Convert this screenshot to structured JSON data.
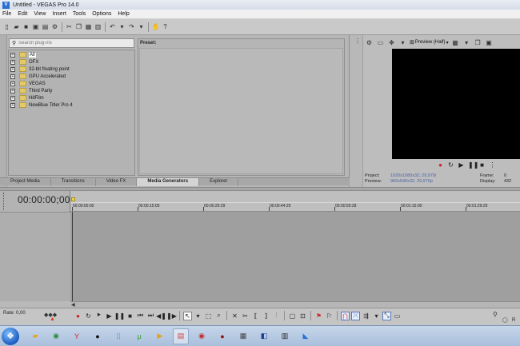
{
  "window": {
    "title": "Untitled - VEGAS Pro 14.0",
    "logo_letter": "V"
  },
  "menu": [
    "File",
    "Edit",
    "View",
    "Insert",
    "Tools",
    "Options",
    "Help"
  ],
  "toolbar_icons": [
    "new-icon",
    "open-icon",
    "save-icon",
    "save-as-icon",
    "render-icon",
    "properties-icon",
    "cut-icon",
    "copy-icon",
    "paste-icon",
    "delete-icon",
    "undo-icon",
    "redo-icon",
    "enable-snapping-icon",
    "whats-this-icon"
  ],
  "plugin_browser": {
    "search_placeholder": "Search plug-ins",
    "items": [
      "All",
      "OFX",
      "32-bit floating point",
      "GPU Accelerated",
      "VEGAS",
      "Third Party",
      "HitFilm",
      "NewBlue Titler Pro 4"
    ],
    "selected_index": 0
  },
  "preset_panel": {
    "header": "Preset:"
  },
  "dock_tabs": [
    {
      "label": "Project Media",
      "active": false
    },
    {
      "label": "Transitions",
      "active": false
    },
    {
      "label": "Video FX",
      "active": false
    },
    {
      "label": "Media Generators",
      "active": true
    },
    {
      "label": "Explorer",
      "active": false
    }
  ],
  "preview": {
    "quality": "Preview (Half)",
    "project_label": "Project:",
    "project_value": "1920x1080x32; 29,970i",
    "preview_label": "Preview:",
    "preview_value": "960x540x32; 29,970p",
    "frame_label": "Frame:",
    "frame_value": "0",
    "display_label": "Display:",
    "display_value": "432"
  },
  "timeline": {
    "timecode": "00:00:00;00",
    "ruler_ticks": [
      "00:00:00:00",
      "00:00:15:00",
      "00:00:29:29",
      "00:00:44:29",
      "00:00:59:28",
      "00:01:15:00",
      "00:01:29:29"
    ]
  },
  "transport": {
    "rate": "Rate: 0,00"
  },
  "taskbar": {
    "apps": [
      "explorer-icon",
      "chrome-icon",
      "yandex-icon",
      "media-icon",
      "files-icon",
      "utorrent-icon",
      "player-icon",
      "vegas-render-icon",
      "app-icon",
      "record-icon",
      "zip-icon",
      "photoshop-icon",
      "word-icon",
      "vegas-icon"
    ]
  }
}
